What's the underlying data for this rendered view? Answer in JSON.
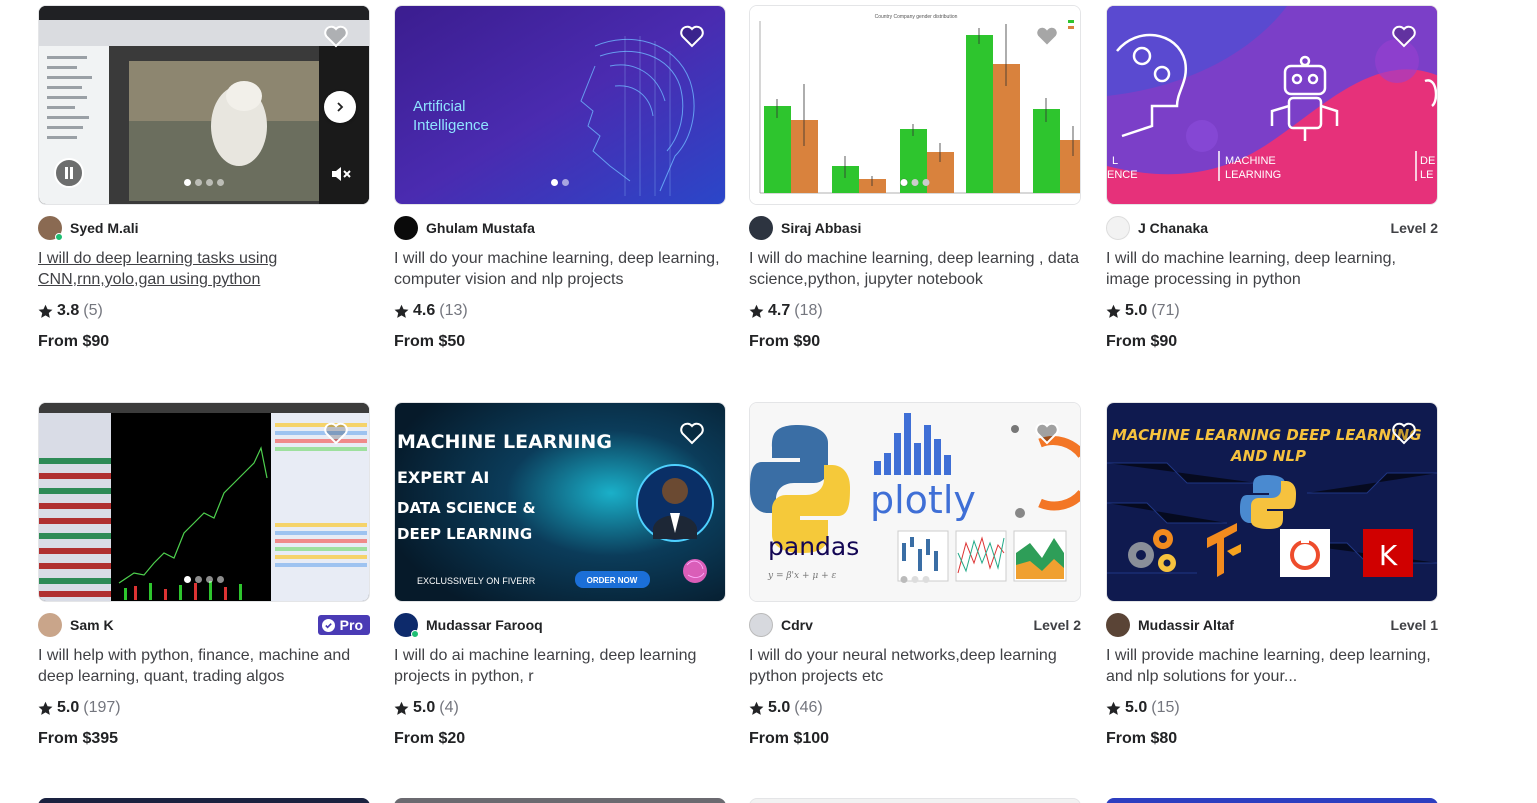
{
  "cards": [
    {
      "seller": "Syed M.ali",
      "level": "",
      "title": "I will do deep learning tasks using CNN,rnn,yolo,gan using python",
      "score": "3.8",
      "count": "(5)",
      "price": "From $90"
    },
    {
      "seller": "Ghulam Mustafa",
      "level": "",
      "title": "I will do your machine learning, deep learning, computer vision and nlp projects",
      "score": "4.6",
      "count": "(13)",
      "price": "From $50",
      "thumb_title_1": "Artificial",
      "thumb_title_2": "Intelligence"
    },
    {
      "seller": "Siraj Abbasi",
      "level": "",
      "title": "I will do machine learning, deep learning , data science,python, jupyter notebook",
      "score": "4.7",
      "count": "(18)",
      "price": "From $90",
      "thumb_chart_title": "Country Company gender distribution"
    },
    {
      "seller": "J Chanaka",
      "level": "Level 2",
      "title": "I will do machine learning, deep learning, image processing in python",
      "score": "5.0",
      "count": "(71)",
      "price": "From $90",
      "thumb_left_text": "L\nENCE",
      "thumb_mid_text_1": "MACHINE",
      "thumb_mid_text_2": "LEARNING",
      "thumb_right_text": "DE\nLE"
    },
    {
      "seller": "Sam K",
      "level": "",
      "badge": "Pro",
      "title": "I will help with python, finance, machine and deep learning, quant, trading algos",
      "score": "5.0",
      "count": "(197)",
      "price": "From $395"
    },
    {
      "seller": "Mudassar Farooq",
      "level": "",
      "title": "I will do ai machine learning, deep learning projects in python, r",
      "score": "5.0",
      "count": "(4)",
      "price": "From $20",
      "thumb_lines": [
        "MACHINE LEARNING",
        "EXPERT   AI",
        "DATA SCIENCE &",
        "DEEP LEARNING"
      ],
      "thumb_footer": "EXCLUSSIVELY ON FIVERR",
      "thumb_cta": "ORDER NOW"
    },
    {
      "seller": "Cdrv",
      "level": "Level 2",
      "title": "I will do your neural networks,deep learning python projects etc",
      "score": "5.0",
      "count": "(46)",
      "price": "From $100",
      "thumb_word_1": "plotly",
      "thumb_word_2": "pandas"
    },
    {
      "seller": "Mudassir Altaf",
      "level": "Level 1",
      "title": "I will provide machine learning, deep learning, and nlp solutions for your...",
      "score": "5.0",
      "count": "(15)",
      "price": "From $80",
      "thumb_head_1": "MACHINE LEARNING DEEP LEARNING",
      "thumb_head_2": "AND NLP"
    }
  ],
  "colors": {
    "online": "#1dbf73",
    "pro": "#4a3bb5",
    "text": "#404145",
    "muted": "#74767e"
  },
  "icons": {
    "heart": "heart-icon",
    "star": "star-icon",
    "arrow": "chevron-right-icon",
    "pause": "pause-icon",
    "mute": "mute-icon"
  }
}
